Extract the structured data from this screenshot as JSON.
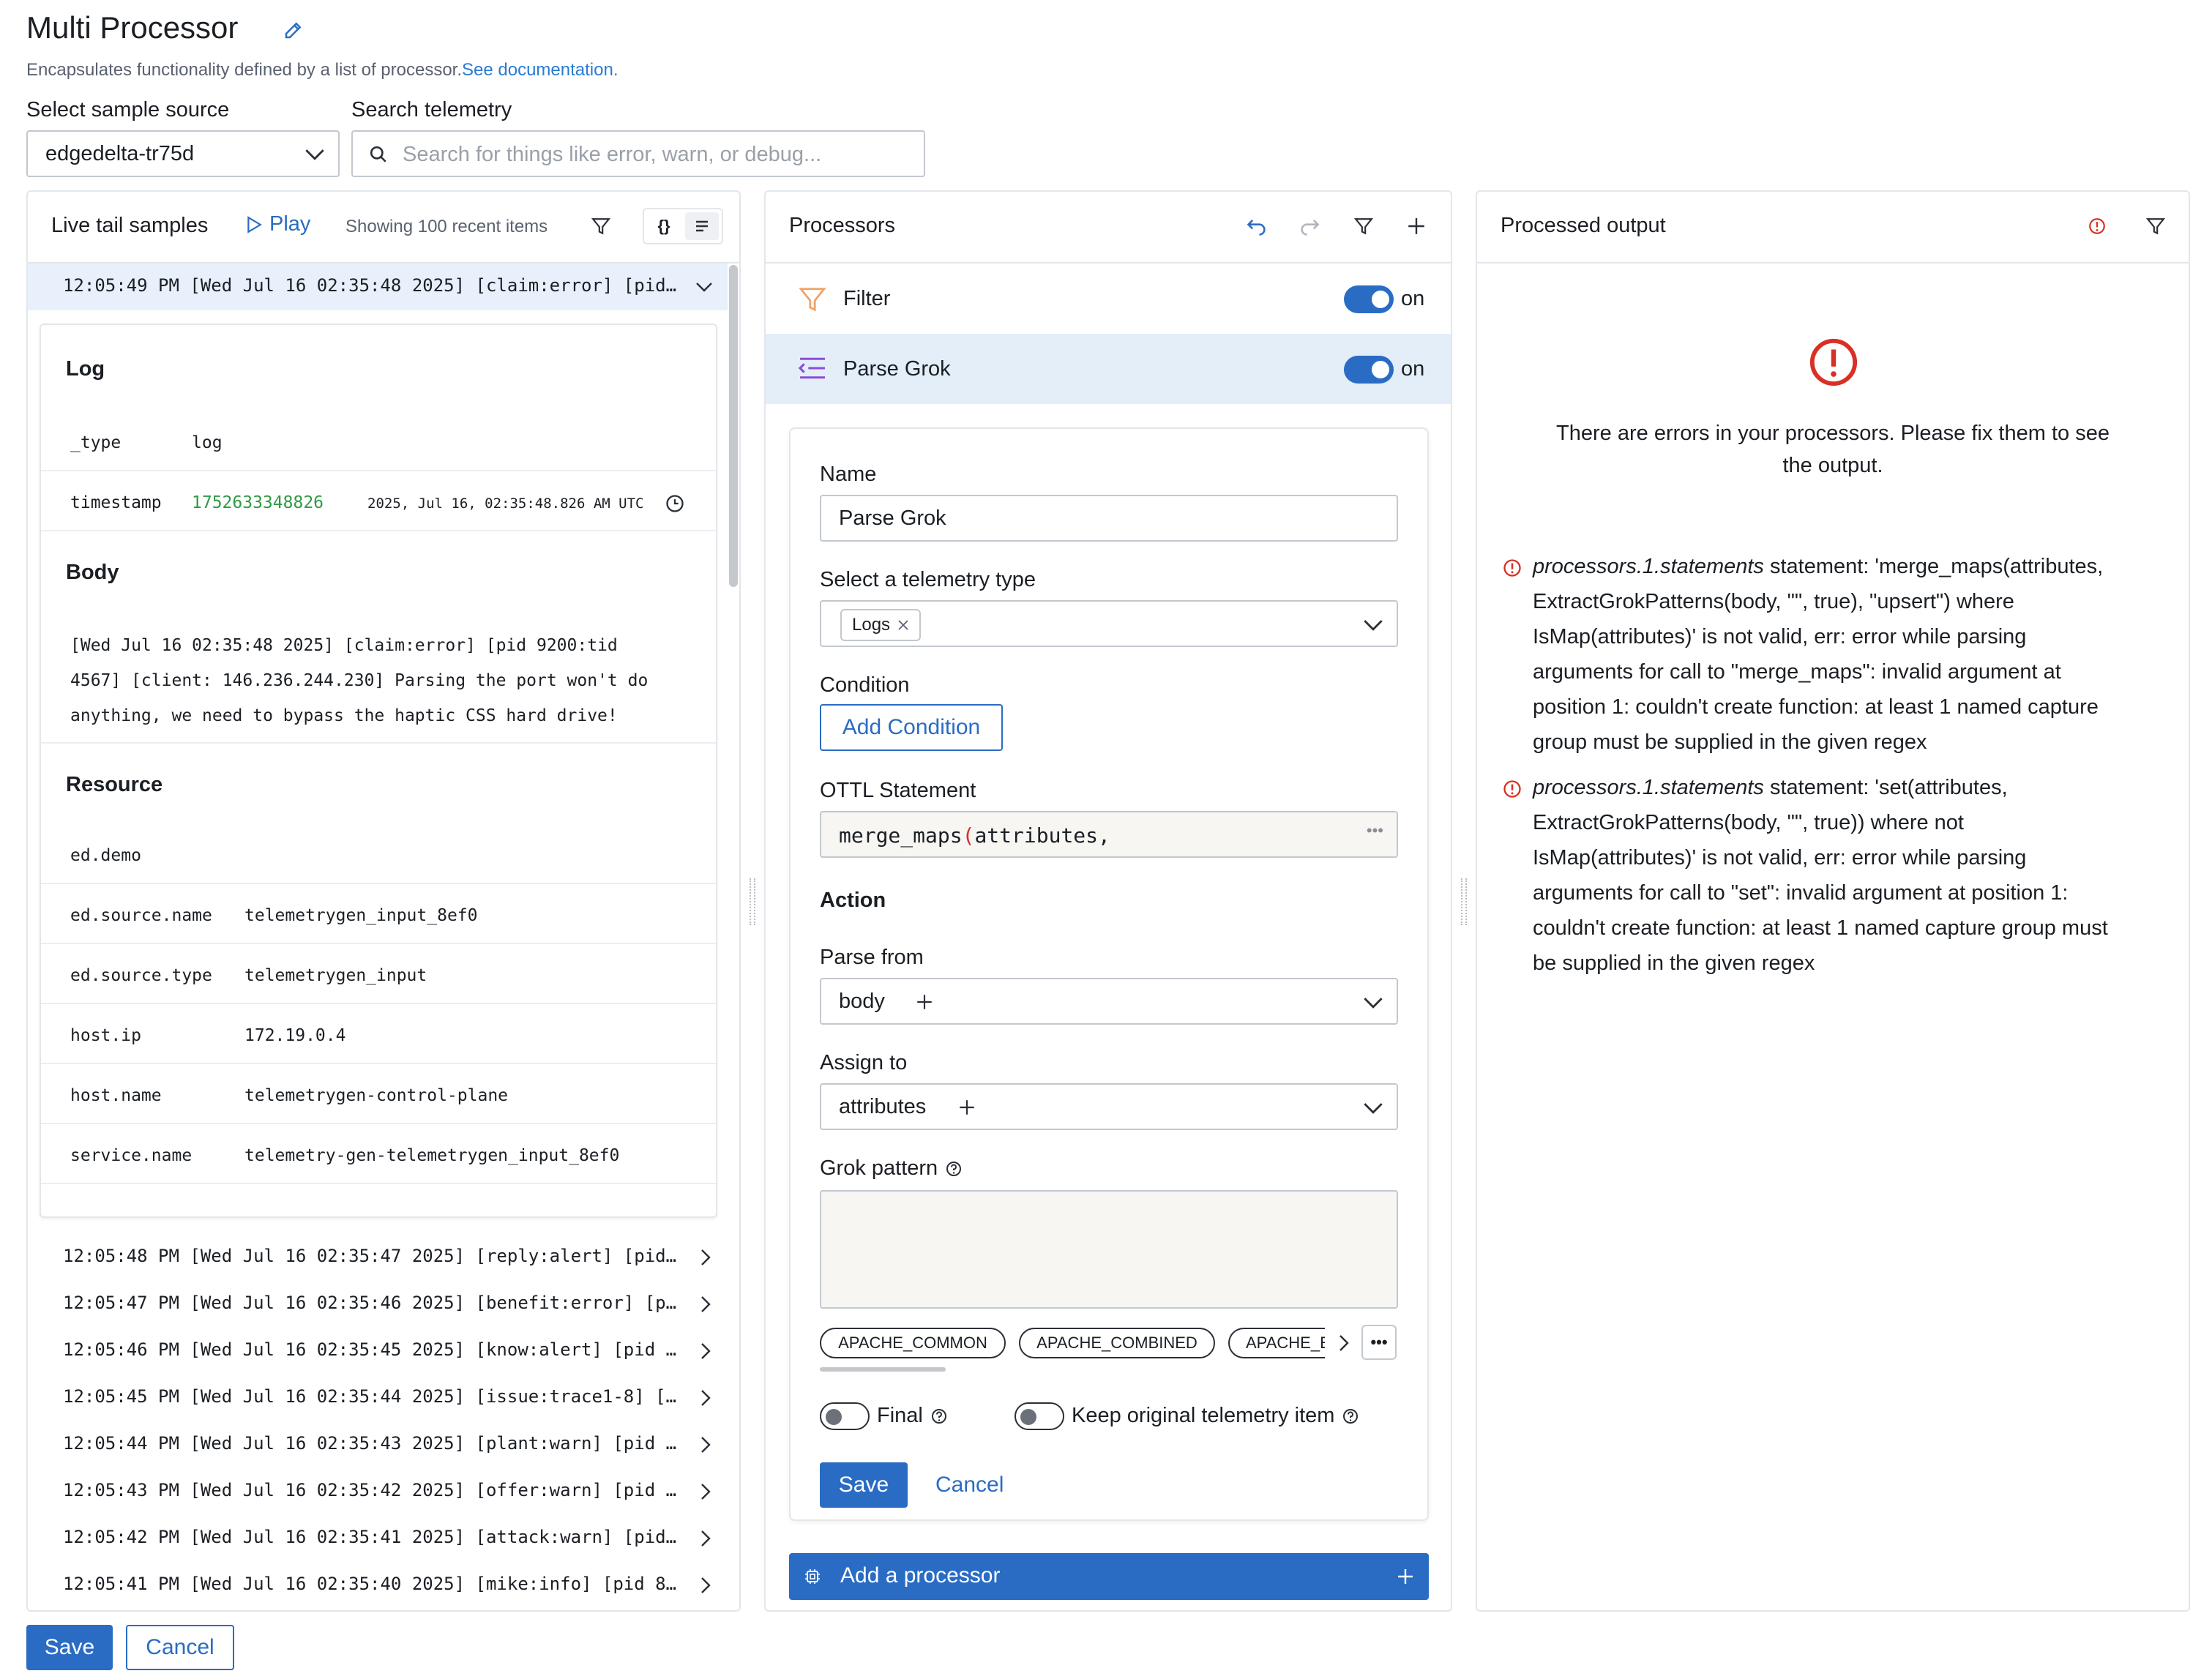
{
  "header": {
    "title": "Multi Processor",
    "subtitle": "Encapsulates functionality defined by a list of processor.",
    "docs_link": "See documentation."
  },
  "source": {
    "label": "Select sample source",
    "value": "edgedelta-tr75d"
  },
  "search": {
    "label": "Search telemetry",
    "placeholder": "Search for things like error, warn, or debug..."
  },
  "live_tail": {
    "title": "Live tail samples",
    "play_label": "Play",
    "count_label": "Showing 100 recent items",
    "expanded_row": "12:05:49 PM [Wed Jul 16 02:35:48 2025] [claim:error] [pid…",
    "log_section": "Log",
    "log_fields": [
      {
        "key": "_type",
        "value": "log"
      },
      {
        "key": "timestamp",
        "value": "1752633348826",
        "extra": "2025, Jul 16, 02:35:48.826 AM UTC"
      }
    ],
    "body_section": "Body",
    "body_lines": [
      "[Wed Jul 16 02:35:48 2025] [claim:error] [pid 9200:tid",
      "4567] [client: 146.236.244.230] Parsing the port won't do",
      "anything, we need to bypass the haptic CSS hard drive!"
    ],
    "resource_section": "Resource",
    "resource_fields": [
      {
        "key": "ed.demo",
        "value": ""
      },
      {
        "key": "ed.source.name",
        "value": "telemetrygen_input_8ef0"
      },
      {
        "key": "ed.source.type",
        "value": "telemetrygen_input"
      },
      {
        "key": "host.ip",
        "value": "172.19.0.4"
      },
      {
        "key": "host.name",
        "value": "telemetrygen-control-plane"
      },
      {
        "key": "service.name",
        "value": "telemetry-gen-telemetrygen_input_8ef0"
      }
    ],
    "rows": [
      "12:05:48 PM [Wed Jul 16 02:35:47 2025] [reply:alert] [pid…",
      "12:05:47 PM [Wed Jul 16 02:35:46 2025] [benefit:error] [p…",
      "12:05:46 PM [Wed Jul 16 02:35:45 2025] [know:alert] [pid …",
      "12:05:45 PM [Wed Jul 16 02:35:44 2025] [issue:trace1-8] […",
      "12:05:44 PM [Wed Jul 16 02:35:43 2025] [plant:warn] [pid …",
      "12:05:43 PM [Wed Jul 16 02:35:42 2025] [offer:warn] [pid …",
      "12:05:42 PM [Wed Jul 16 02:35:41 2025] [attack:warn] [pid…",
      "12:05:41 PM [Wed Jul 16 02:35:40 2025] [mike:info] [pid 8…"
    ]
  },
  "processors": {
    "title": "Processors",
    "items": [
      {
        "label": "Filter",
        "toggle": "on"
      },
      {
        "label": "Parse Grok",
        "toggle": "on"
      }
    ],
    "form": {
      "name_label": "Name",
      "name_value": "Parse Grok",
      "telemetry_label": "Select a telemetry type",
      "telemetry_chip": "Logs",
      "condition_label": "Condition",
      "add_condition": "Add Condition",
      "ottl_label": "OTTL Statement",
      "ottl_value_fn": "merge_maps",
      "ottl_value_paren": "(",
      "ottl_value_arg": "attributes,",
      "action_label": "Action",
      "parse_from_label": "Parse from",
      "parse_from_value": "body",
      "assign_to_label": "Assign to",
      "assign_to_value": "attributes",
      "grok_label": "Grok pattern",
      "patterns": [
        "APACHE_COMMON",
        "APACHE_COMBINED",
        "APACHE_ERROR"
      ],
      "final_label": "Final",
      "keep_label": "Keep original telemetry item",
      "save": "Save",
      "cancel": "Cancel"
    },
    "add_processor": "Add a processor"
  },
  "output": {
    "title": "Processed output",
    "message_line1": "There are errors in your processors. Please fix them to see",
    "message_line2": "the output.",
    "errors": [
      {
        "path": "processors.1.statements",
        "lines": [
          " statement: 'merge_maps(attributes,",
          "ExtractGrokPatterns(body, \"\", true), \"upsert\") where",
          "IsMap(attributes)' is not valid, err: error while parsing",
          "arguments for call to \"merge_maps\": invalid argument at",
          "position 1: couldn't create function: at least 1 named capture",
          "group must be supplied in the given regex"
        ]
      },
      {
        "path": "processors.1.statements",
        "lines": [
          " statement: 'set(attributes,",
          "ExtractGrokPatterns(body, \"\", true)) where not",
          "IsMap(attributes)' is not valid, err: error while parsing",
          "arguments for call to \"set\": invalid argument at position 1:",
          "couldn't create function: at least 1 named capture group must",
          "be supplied in the given regex"
        ]
      }
    ]
  },
  "footer": {
    "save": "Save",
    "cancel": "Cancel"
  },
  "colors": {
    "primary": "#2a6cc4",
    "link": "#2a7bd2",
    "error": "#d93025",
    "timestamp_green": "#2f9a44",
    "selected_row_bg": "#e8f0fb"
  }
}
